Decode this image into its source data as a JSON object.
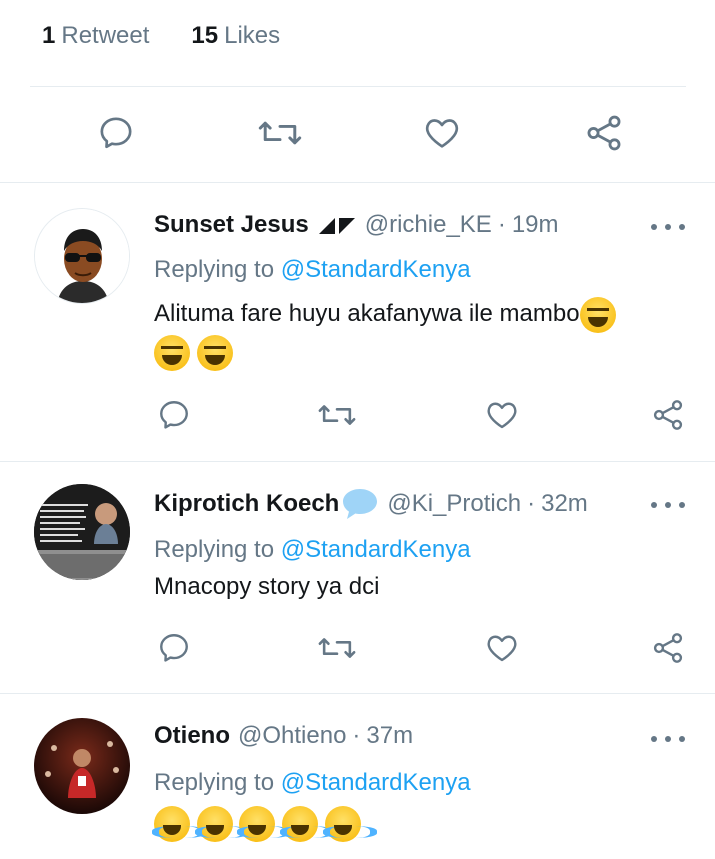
{
  "stats": {
    "retweets": {
      "count": "1",
      "label": "Retweet"
    },
    "likes": {
      "count": "15",
      "label": "Likes"
    }
  },
  "main_actions": [
    "reply-icon",
    "retweet-icon",
    "like-icon",
    "share-icon"
  ],
  "colors": {
    "accent": "#1da1f2",
    "icon": "#657786",
    "text": "#14171a",
    "muted": "#657786",
    "divider": "#e6ecf0"
  },
  "tweets": [
    {
      "name": "Sunset Jesus",
      "handle": "@richie_KE",
      "dot": "·",
      "time": "19m",
      "replying_prefix": "Replying to",
      "replying_to": "@StandardKenya",
      "text": "Alituma fare huyu akafanywa ile mambo",
      "emoji": [
        "grinning-squinting-face",
        "grinning-squinting-face",
        "grinning-squinting-face"
      ]
    },
    {
      "name": "Kiprotich Koech",
      "handle": "@Ki_Protich",
      "dot": "·",
      "time": "32m",
      "replying_prefix": "Replying to",
      "replying_to": "@StandardKenya",
      "text": "Mnacopy story ya dci",
      "emoji": []
    },
    {
      "name": "Otieno",
      "handle": "@Ohtieno",
      "dot": "·",
      "time": "37m",
      "replying_prefix": "Replying to",
      "replying_to": "@StandardKenya",
      "text": "",
      "emoji": [
        "face-with-tears-of-joy",
        "face-with-tears-of-joy",
        "face-with-tears-of-joy",
        "face-with-tears-of-joy",
        "face-with-tears-of-joy"
      ]
    }
  ]
}
